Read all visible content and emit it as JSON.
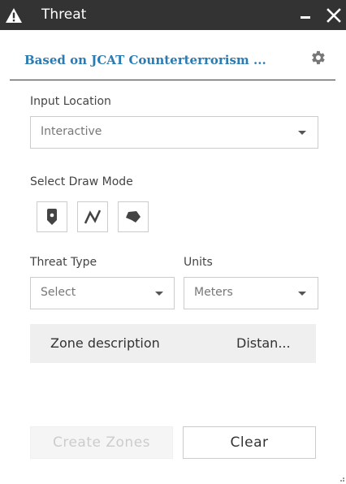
{
  "window": {
    "title": "Threat"
  },
  "header": {
    "subtitle": "Based on JCAT Counterterrorism ..."
  },
  "input_location": {
    "label": "Input Location",
    "value": "Interactive"
  },
  "draw_mode": {
    "label": "Select Draw Mode",
    "tools": [
      "point-icon",
      "polyline-icon",
      "polygon-icon"
    ]
  },
  "threat_type": {
    "label": "Threat Type",
    "value": "Select"
  },
  "units": {
    "label": "Units",
    "value": "Meters"
  },
  "table": {
    "columns": [
      "Zone description",
      "Distan..."
    ]
  },
  "buttons": {
    "create": "Create Zones",
    "clear": "Clear"
  },
  "colors": {
    "titlebar": "#333333",
    "accent": "#2b7bb3",
    "table_header": "#efefef"
  }
}
